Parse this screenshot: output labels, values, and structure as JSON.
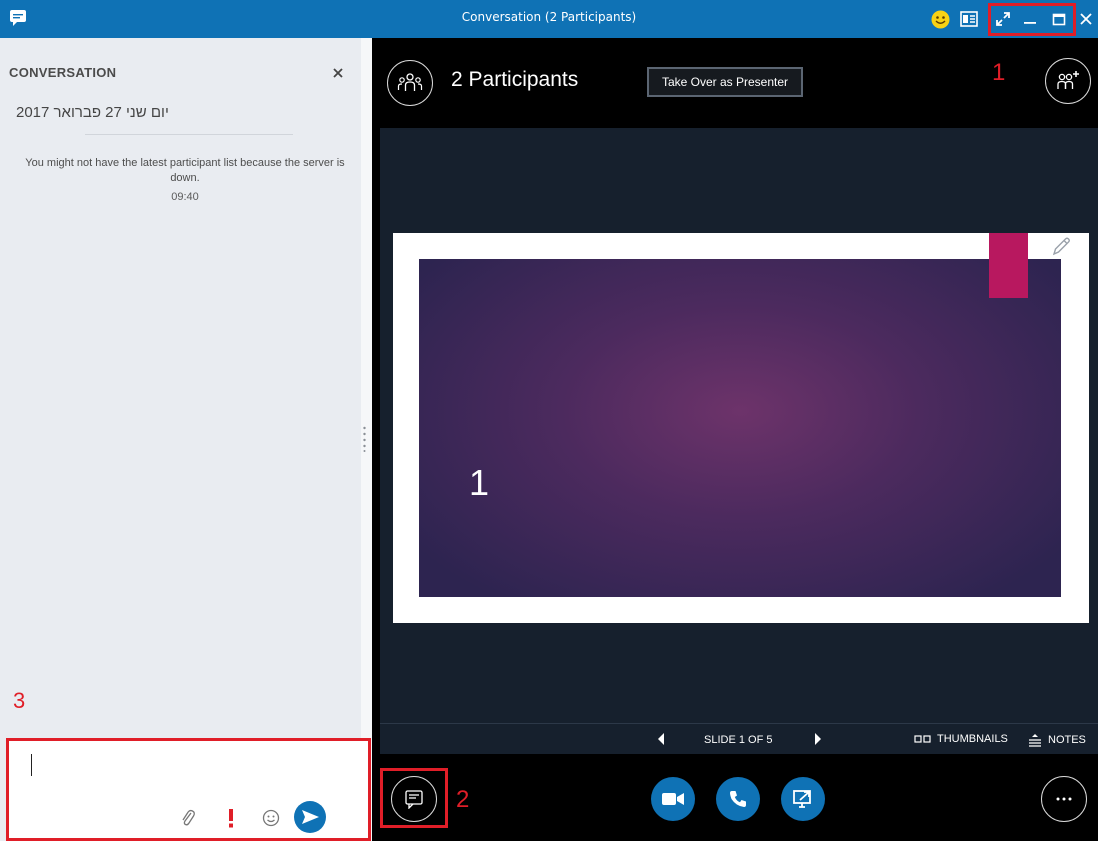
{
  "window": {
    "title": "Conversation (2 Participants)"
  },
  "chat": {
    "header": "CONVERSATION",
    "date": "יום שני 27 פברואר 2017",
    "notice": "You might not have the latest participant list because the server is down.",
    "notice_time": "09:40",
    "compose_value": ""
  },
  "stage": {
    "participants_label": "2 Participants",
    "takeover_label": "Take Over as Presenter",
    "slide_number_text": "1",
    "slide_counter": "SLIDE 1 OF 5",
    "thumbnails_label": "THUMBNAILS",
    "notes_label": "NOTES"
  },
  "annotations": {
    "label_1": "1",
    "label_2": "2",
    "label_3": "3"
  },
  "icons": {
    "app": "chat-bubble-icon",
    "emoji": "smiley-icon",
    "layout": "layout-icon",
    "fullscreen": "expand-icon",
    "minimize": "minimize-icon",
    "maximize": "maximize-icon",
    "close": "close-icon",
    "attach": "paperclip-icon",
    "priority": "exclamation-icon",
    "emoticon": "emoticon-icon",
    "send": "send-icon",
    "participants": "participants-icon",
    "add_people": "add-people-icon",
    "annotate": "pencil-icon",
    "video": "video-camera-icon",
    "call": "phone-icon",
    "present": "present-screen-icon",
    "more": "more-options-icon"
  },
  "colors": {
    "titlebar": "#0f72b5",
    "accent": "#0f72b5",
    "highlight": "#e01e28",
    "stage": "#16202d",
    "slide_bookmark": "#b8185f"
  }
}
